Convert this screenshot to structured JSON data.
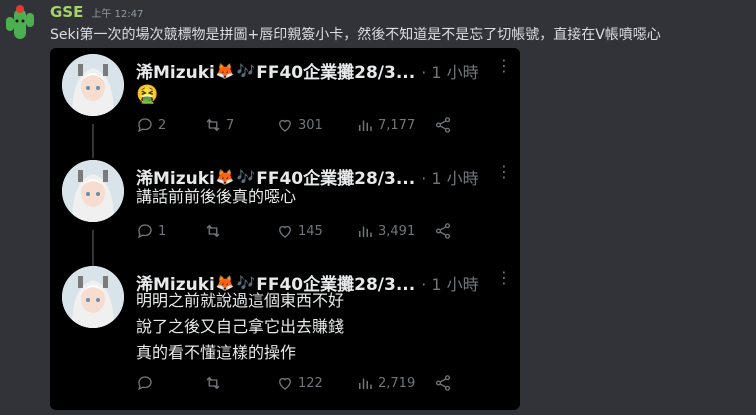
{
  "message": {
    "username": "GSE",
    "timestamp": "上午 12:47",
    "text": "Seki第一次的場次競標物是拼圖+唇印親簽小卡，然後不知道是不是忘了切帳號，直接在V帳噴噁心"
  },
  "tweets": [
    {
      "author": "浠Mizuki",
      "author_suffix": "FF40企業攤28/3...",
      "time": "· 1 小時",
      "body_lines": [
        "🤮"
      ],
      "replies": "2",
      "retweets": "7",
      "likes": "301",
      "views": "7,177"
    },
    {
      "author": "浠Mizuki",
      "author_suffix": "FF40企業攤28/3...",
      "time": "· 1 小時",
      "body_lines": [
        "講話前前後後真的噁心"
      ],
      "replies": "1",
      "retweets": "",
      "likes": "145",
      "views": "3,491"
    },
    {
      "author": "浠Mizuki",
      "author_suffix": "FF40企業攤28/3...",
      "time": "· 1 小時",
      "body_lines": [
        "明明之前就說過這個東西不好",
        "說了之後又自己拿它出去賺錢",
        "真的看不懂這樣的操作"
      ],
      "replies": "",
      "retweets": "",
      "likes": "122",
      "views": "2,719"
    }
  ],
  "icons": {
    "fox": "🦊",
    "music": "🎶",
    "more": "⋮"
  },
  "colors": {
    "background": "#313338",
    "username": "#a6d46a",
    "embed_bg": "#000000",
    "tweet_text": "#e7e9ea",
    "muted": "#71767b"
  }
}
